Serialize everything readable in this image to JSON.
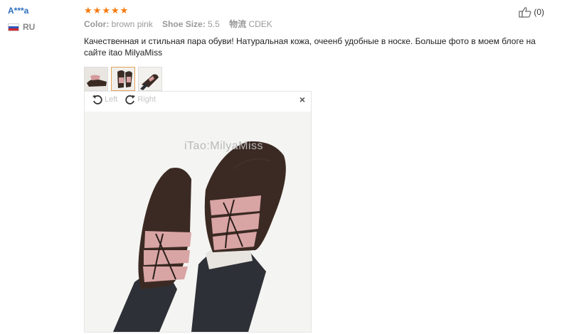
{
  "user": {
    "name": "A***a",
    "country": "RU"
  },
  "rating": {
    "stars": 5
  },
  "attributes": [
    {
      "key": "Color:",
      "value": "brown pink"
    },
    {
      "key": "Shoe Size:",
      "value": "5.5"
    },
    {
      "key": "物流",
      "value": "CDEK"
    }
  ],
  "review": {
    "text": "Качественная и стильная пара обуви! Натуральная кожа, очеенб удобные в носке. Больше фото в моем блоге на сайте itao MilyaMiss"
  },
  "viewer": {
    "left_label": "Left",
    "right_label": "Right",
    "close": "×",
    "watermark": "iTao:MilyaMiss"
  },
  "like": {
    "count": "(0)"
  },
  "colors": {
    "star": "#f57a0c",
    "username": "#2d6fbf",
    "active_thumb": "#e4a35a"
  }
}
